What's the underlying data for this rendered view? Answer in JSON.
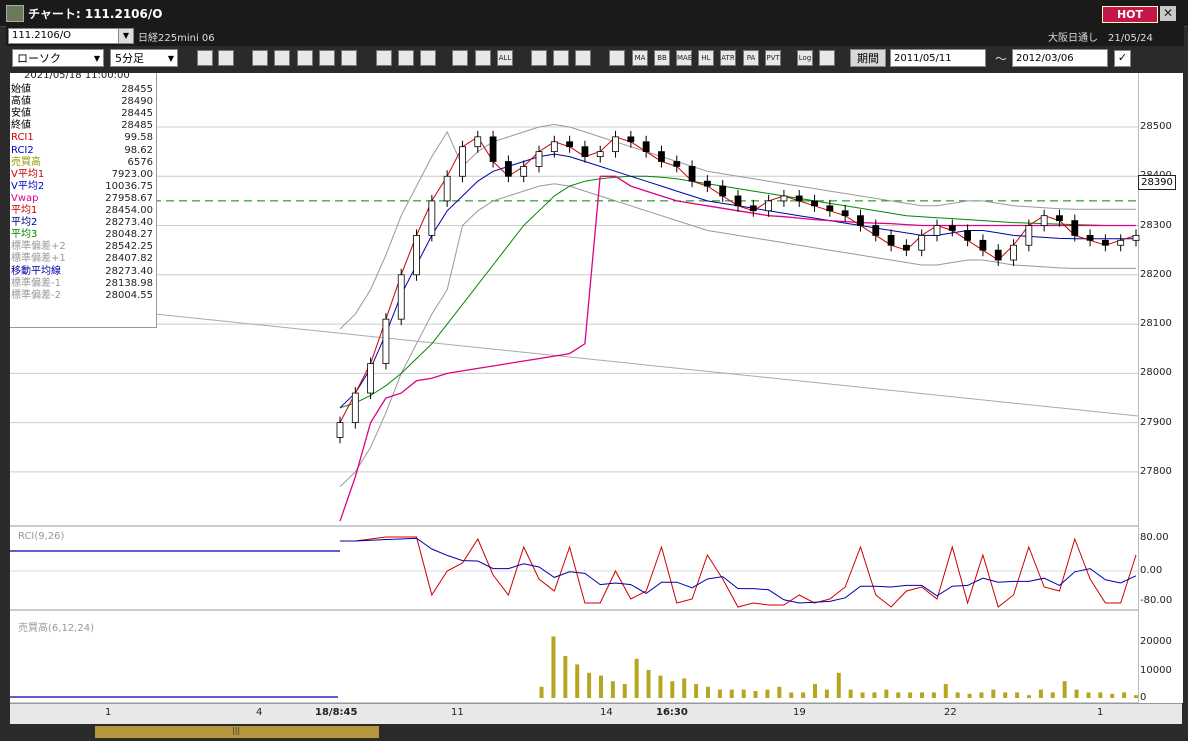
{
  "window": {
    "title": "チャート: 111.2106/O",
    "hot_label": "HOT",
    "close_label": "✕"
  },
  "symbol": {
    "code": "111.2106/O",
    "name": "日経225mini 06",
    "exchange": "大阪日通し　21/05/24"
  },
  "toolbar": {
    "chart_type": "ローソク",
    "interval": "5分足",
    "icons": [
      "zoom-icon",
      "grid-icon",
      "cursor-icon",
      "magnify-icon",
      "chart1-icon",
      "chart2-icon",
      "chart3-icon",
      "draw-icon",
      "arrow-icon",
      "undo-icon",
      "bar1-icon",
      "bar2-icon",
      "all-icon",
      "settings-icon",
      "pencil-icon",
      "color-icon",
      "ma-icon",
      "mar-icon",
      "bb-icon",
      "mae-icon",
      "hl-icon",
      "atr-icon",
      "para-icon",
      "pvt-icon",
      "log-icon",
      "fit-icon"
    ],
    "icon_labels": [
      "",
      "",
      "",
      "",
      "",
      "",
      "",
      "",
      "",
      "",
      "",
      "",
      "ALL",
      "",
      "",
      "",
      "",
      "MA",
      "BB",
      "MAE",
      "HL",
      "ATR",
      "PA RA",
      "PVT",
      "Log",
      ""
    ],
    "period_label": "期間",
    "date_from": "2011/05/11",
    "date_to": "2012/03/06",
    "tilde": "～",
    "check": "✓"
  },
  "info": {
    "datetime": "2021/05/18  11:00:00",
    "rows": [
      {
        "label": "始値",
        "value": "28455",
        "color": "#000000"
      },
      {
        "label": "高値",
        "value": "28490",
        "color": "#000000"
      },
      {
        "label": "安値",
        "value": "28445",
        "color": "#000000"
      },
      {
        "label": "終値",
        "value": "28485",
        "color": "#000000"
      },
      {
        "label": "RCI1",
        "value": "99.58",
        "color": "#cc0000"
      },
      {
        "label": "RCI2",
        "value": "98.62",
        "color": "#0000cc"
      },
      {
        "label": "売買高",
        "value": "6576",
        "color": "#999900"
      },
      {
        "label": "V平均1",
        "value": "7923.00",
        "color": "#cc0000"
      },
      {
        "label": "V平均2",
        "value": "10036.75",
        "color": "#0000cc"
      },
      {
        "label": "Vwap",
        "value": "27958.67",
        "color": "#dd0088"
      },
      {
        "label": "平均1",
        "value": "28454.00",
        "color": "#cc0000"
      },
      {
        "label": "平均2",
        "value": "28273.40",
        "color": "#000088"
      },
      {
        "label": "平均3",
        "value": "28048.27",
        "color": "#008800"
      },
      {
        "label": "標準偏差+2",
        "value": "28542.25",
        "color": "#999999"
      },
      {
        "label": "標準偏差+1",
        "value": "28407.82",
        "color": "#999999"
      },
      {
        "label": "移動平均線",
        "value": "28273.40",
        "color": "#0000aa"
      },
      {
        "label": "標準偏差-1",
        "value": "28138.98",
        "color": "#999999"
      },
      {
        "label": "標準偏差-2",
        "value": "28004.55",
        "color": "#999999"
      }
    ]
  },
  "chart_data": {
    "type": "line",
    "title": "",
    "y_ticks": [
      28500,
      28400,
      28300,
      28200,
      28100,
      28000,
      27900,
      27800
    ],
    "y_ticks_labels": [
      "28500",
      "28400",
      "28300",
      "28200",
      "28100",
      "28000",
      "27900",
      "27800"
    ],
    "current_price": "28390",
    "x_labels": [
      {
        "label": "1",
        "bold": false
      },
      {
        "label": "4",
        "bold": false
      },
      {
        "label": "18/8:45",
        "bold": true
      },
      {
        "label": "11",
        "bold": false
      },
      {
        "label": "14",
        "bold": false
      },
      {
        "label": "16:30",
        "bold": true
      },
      {
        "label": "19",
        "bold": false
      },
      {
        "label": "22",
        "bold": false
      },
      {
        "label": "1",
        "bold": false
      }
    ],
    "rci_label": "RCI(9,26)",
    "rci_ticks": [
      "80.00",
      "0.00",
      "-80.00"
    ],
    "volume_label": "売買高(6,12,24)",
    "volume_ticks": [
      "20000",
      "10000",
      "0"
    ],
    "price_series": {
      "close": [
        27900,
        27960,
        28020,
        28110,
        28200,
        28280,
        28350,
        28400,
        28460,
        28480,
        28430,
        28400,
        28420,
        28450,
        28470,
        28460,
        28440,
        28450,
        28480,
        28470,
        28450,
        28430,
        28420,
        28390,
        28380,
        28360,
        28340,
        28330,
        28350,
        28360,
        28350,
        28340,
        28330,
        28320,
        28300,
        28280,
        28260,
        28250,
        28280,
        28300,
        28290,
        28270,
        28250,
        28230,
        28260,
        28300,
        28320,
        28310,
        28280,
        28270,
        28260,
        28270,
        28280
      ],
      "vwap": [
        27700,
        27790,
        27900,
        27950,
        27960,
        27985,
        27990,
        28000,
        28005,
        28010,
        28015,
        28020,
        28025,
        28030,
        28035,
        28040,
        28060,
        28400,
        28400,
        28380,
        28370,
        28360,
        28350,
        28345,
        28340,
        28335,
        28330,
        28325,
        28320,
        28318,
        28315,
        28312,
        28310,
        28308,
        28306,
        28305,
        28304,
        28302,
        28300,
        28300,
        28300,
        28300,
        28300,
        28300,
        28300,
        28300,
        28300,
        28300,
        28300,
        28300,
        28300,
        28300,
        28300
      ],
      "ma2": [
        27930,
        27960,
        28010,
        28080,
        28160,
        28220,
        28280,
        28330,
        28360,
        28390,
        28410,
        28420,
        28430,
        28440,
        28445,
        28440,
        28430,
        28420,
        28410,
        28400,
        28390,
        28380,
        28370,
        28360,
        28350,
        28345,
        28340,
        28335,
        28330,
        28325,
        28320,
        28315,
        28310,
        28305,
        28300,
        28295,
        28290,
        28285,
        28280,
        28280,
        28285,
        28290,
        28290,
        28285,
        28280,
        28278,
        28276,
        28274,
        28273,
        28273,
        28273,
        28273,
        28273
      ],
      "ma3": [
        27930,
        27940,
        27955,
        27975,
        28000,
        28030,
        28060,
        28100,
        28140,
        28180,
        28220,
        28260,
        28300,
        28330,
        28360,
        28380,
        28390,
        28395,
        28398,
        28400,
        28400,
        28398,
        28395,
        28390,
        28385,
        28380,
        28375,
        28370,
        28365,
        28360,
        28355,
        28350,
        28345,
        28340,
        28335,
        28330,
        28325,
        28320,
        28318,
        28316,
        28314,
        28312,
        28310,
        28308,
        28306,
        28305,
        28304,
        28303,
        28302,
        28301,
        28300,
        28300,
        28300
      ],
      "rci": [
        75,
        75,
        80,
        85,
        85,
        85,
        -60,
        0,
        20,
        80,
        -10,
        -60,
        60,
        -20,
        -50,
        60,
        -80,
        -80,
        0,
        -70,
        -50,
        60,
        -80,
        -70,
        40,
        -20,
        -90,
        -80,
        -85,
        -85,
        -60,
        -80,
        -70,
        -40,
        60,
        -60,
        -90,
        -50,
        -40,
        -70,
        60,
        -80,
        40,
        -90,
        -60,
        60,
        -40,
        -50,
        80,
        -20,
        -80,
        -80,
        40
      ]
    },
    "volume": [
      0,
      0,
      0,
      0,
      0,
      0,
      0,
      0,
      0,
      0,
      0,
      0,
      0,
      0,
      0,
      0,
      0,
      0,
      0,
      0,
      0,
      0,
      4000,
      22000,
      15000,
      12000,
      9000,
      8000,
      6000,
      5000,
      14000,
      10000,
      8000,
      6000,
      7000,
      5000,
      4000,
      3000,
      3000,
      3000,
      2500,
      3000,
      4000,
      2000,
      2000,
      5000,
      3000,
      9000,
      3000,
      2000,
      2000,
      3000,
      2000,
      2000,
      2000,
      2000,
      5000,
      2000,
      1500,
      2000,
      3000,
      2000,
      2000,
      1000,
      3000,
      2000,
      6000,
      3000,
      2000,
      2000,
      1500,
      2000,
      1000
    ]
  },
  "colors": {
    "vwap": "#dd0088",
    "ma1": "#cc0000",
    "ma2": "#0000aa",
    "ma3": "#008800",
    "bb": "#999999",
    "rci1": "#cc0000",
    "rci2": "#0000aa",
    "volume": "#b5a620",
    "hline": "#008800"
  }
}
